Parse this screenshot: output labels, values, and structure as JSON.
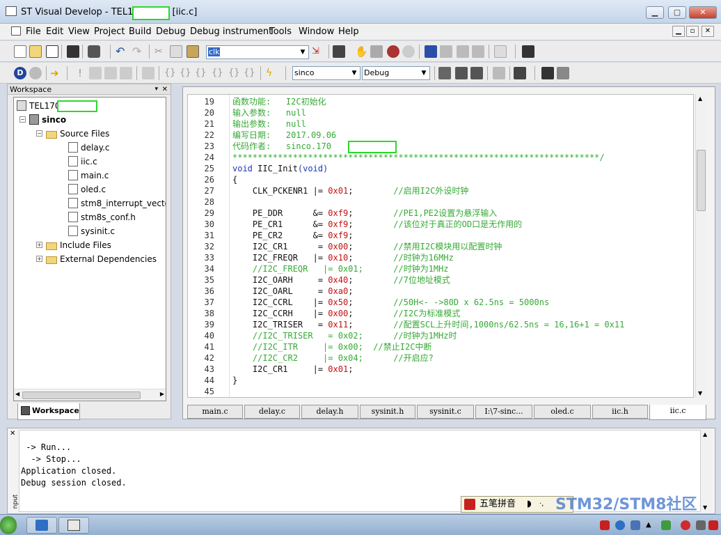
{
  "window": {
    "title": "ST Visual Develop - TEL170        stw - [iic.c]",
    "min": "▁",
    "max": "▢",
    "close": "✕"
  },
  "menu": {
    "items": [
      "File",
      "Edit",
      "View",
      "Project",
      "Build",
      "Debug",
      "Debug instrument",
      "Tools",
      "Window",
      "Help"
    ]
  },
  "toolbar1": {
    "find_value": "clk"
  },
  "toolbar2": {
    "target": "sinco",
    "config": "Debug"
  },
  "workspace": {
    "title": "Workspace",
    "tree": {
      "root": "TEL170          stw",
      "project": "sinco",
      "source_folder": "Source Files",
      "files": [
        "delay.c",
        "iic.c",
        "main.c",
        "oled.c",
        "stm8_interrupt_vecto",
        "stm8s_conf.h",
        "sysinit.c"
      ],
      "include_folder": "Include Files",
      "external_folder": "External Dependencies"
    },
    "tab": "Workspace"
  },
  "editor": {
    "lines": [
      {
        "n": "19",
        "parts": [
          [
            "cm",
            "函数功能:   I2C初始化"
          ]
        ]
      },
      {
        "n": "20",
        "parts": [
          [
            "cm",
            "输入参数:   null"
          ]
        ]
      },
      {
        "n": "21",
        "parts": [
          [
            "cm",
            "输出参数:   null"
          ]
        ]
      },
      {
        "n": "22",
        "parts": [
          [
            "cm",
            "编写日期:   2017.09.06"
          ]
        ]
      },
      {
        "n": "23",
        "parts": [
          [
            "cm",
            "代码作者:   sinco.170"
          ]
        ]
      },
      {
        "n": "24",
        "parts": [
          [
            "cm",
            "*************************************************************************/"
          ]
        ]
      },
      {
        "n": "25",
        "parts": [
          [
            "kw",
            "void "
          ],
          [
            "id",
            "IIC_Init"
          ],
          [
            "kw",
            "(void)"
          ]
        ]
      },
      {
        "n": "26",
        "parts": [
          [
            "id",
            "{"
          ]
        ]
      },
      {
        "n": "27",
        "parts": [
          [
            "id",
            "    CLK_PCKENR1 |= "
          ],
          [
            "nm",
            "0x01"
          ],
          [
            "id",
            ";        "
          ],
          [
            "cm",
            "//启用I2C外设时钟"
          ]
        ]
      },
      {
        "n": "28",
        "parts": []
      },
      {
        "n": "29",
        "parts": [
          [
            "id",
            "    PE_DDR      &= "
          ],
          [
            "nm",
            "0xf9"
          ],
          [
            "id",
            ";        "
          ],
          [
            "cm",
            "//PE1,PE2设置为悬浮输入"
          ]
        ]
      },
      {
        "n": "30",
        "parts": [
          [
            "id",
            "    PE_CR1      &= "
          ],
          [
            "nm",
            "0xf9"
          ],
          [
            "id",
            ";        "
          ],
          [
            "cm",
            "//该位对于真正的OD口是无作用的"
          ]
        ]
      },
      {
        "n": "31",
        "parts": [
          [
            "id",
            "    PE_CR2      &= "
          ],
          [
            "nm",
            "0xf9"
          ],
          [
            "id",
            ";"
          ]
        ]
      },
      {
        "n": "32",
        "parts": [
          [
            "id",
            "    I2C_CR1      = "
          ],
          [
            "nm",
            "0x00"
          ],
          [
            "id",
            ";        "
          ],
          [
            "cm",
            "//禁用I2C模块用以配置时钟"
          ]
        ]
      },
      {
        "n": "33",
        "parts": [
          [
            "id",
            "    I2C_FREQR   |= "
          ],
          [
            "nm",
            "0x10"
          ],
          [
            "id",
            ";        "
          ],
          [
            "cm",
            "//时钟为16MHz"
          ]
        ]
      },
      {
        "n": "34",
        "parts": [
          [
            "cm",
            "    //I2C_FREQR   |= 0x01;      //时钟为1MHz"
          ]
        ]
      },
      {
        "n": "35",
        "parts": [
          [
            "id",
            "    I2C_OARH     = "
          ],
          [
            "nm",
            "0x40"
          ],
          [
            "id",
            ";        "
          ],
          [
            "cm",
            "//7位地址模式"
          ]
        ]
      },
      {
        "n": "36",
        "parts": [
          [
            "id",
            "    I2C_OARL     = "
          ],
          [
            "nm",
            "0xa0"
          ],
          [
            "id",
            ";"
          ]
        ]
      },
      {
        "n": "37",
        "parts": [
          [
            "id",
            "    I2C_CCRL    |= "
          ],
          [
            "nm",
            "0x50"
          ],
          [
            "id",
            ";        "
          ],
          [
            "cm",
            "//50H<- ->80D x 62.5ns = 5000ns"
          ]
        ]
      },
      {
        "n": "38",
        "parts": [
          [
            "id",
            "    I2C_CCRH    |= "
          ],
          [
            "nm",
            "0x00"
          ],
          [
            "id",
            ";        "
          ],
          [
            "cm",
            "//I2C为标准模式"
          ]
        ]
      },
      {
        "n": "39",
        "parts": [
          [
            "id",
            "    I2C_TRISER   = "
          ],
          [
            "nm",
            "0x11"
          ],
          [
            "id",
            ";        "
          ],
          [
            "cm",
            "//配置SCL上升时间,1000ns/62.5ns = 16,16+1 = 0x11"
          ]
        ]
      },
      {
        "n": "40",
        "parts": [
          [
            "cm",
            "    //I2C_TRISER   = 0x02;      //时钟为1MHz时"
          ]
        ]
      },
      {
        "n": "41",
        "parts": [
          [
            "cm",
            "    //I2C_ITR     |= 0x00;  //禁止I2C中断"
          ]
        ]
      },
      {
        "n": "42",
        "parts": [
          [
            "cm",
            "    //I2C_CR2     |= 0x04;      //开启应?"
          ]
        ]
      },
      {
        "n": "43",
        "parts": [
          [
            "id",
            "    I2C_CR1     |= "
          ],
          [
            "nm",
            "0x01"
          ],
          [
            "id",
            ";"
          ]
        ]
      },
      {
        "n": "44",
        "parts": [
          [
            "id",
            "}"
          ]
        ]
      },
      {
        "n": "45",
        "parts": []
      }
    ],
    "tabs": [
      "main.c",
      "delay.c",
      "delay.h",
      "sysinit.h",
      "sysinit.c",
      "I:\\7-sinc...",
      "oled.c",
      "iic.h",
      "iic.c"
    ],
    "active_tab": "iic.c"
  },
  "output": {
    "text": " -> Run...\n  -> Stop...\nApplication closed.\nDebug session closed.",
    "side_label": "nput"
  },
  "ime": {
    "label": "五笔拼音"
  },
  "watermark": "STM32/STM8社区",
  "colors": {
    "comment": "#35a935",
    "keyword": "#1c37b5",
    "number": "#c01010",
    "redact": "#2bd82b"
  }
}
